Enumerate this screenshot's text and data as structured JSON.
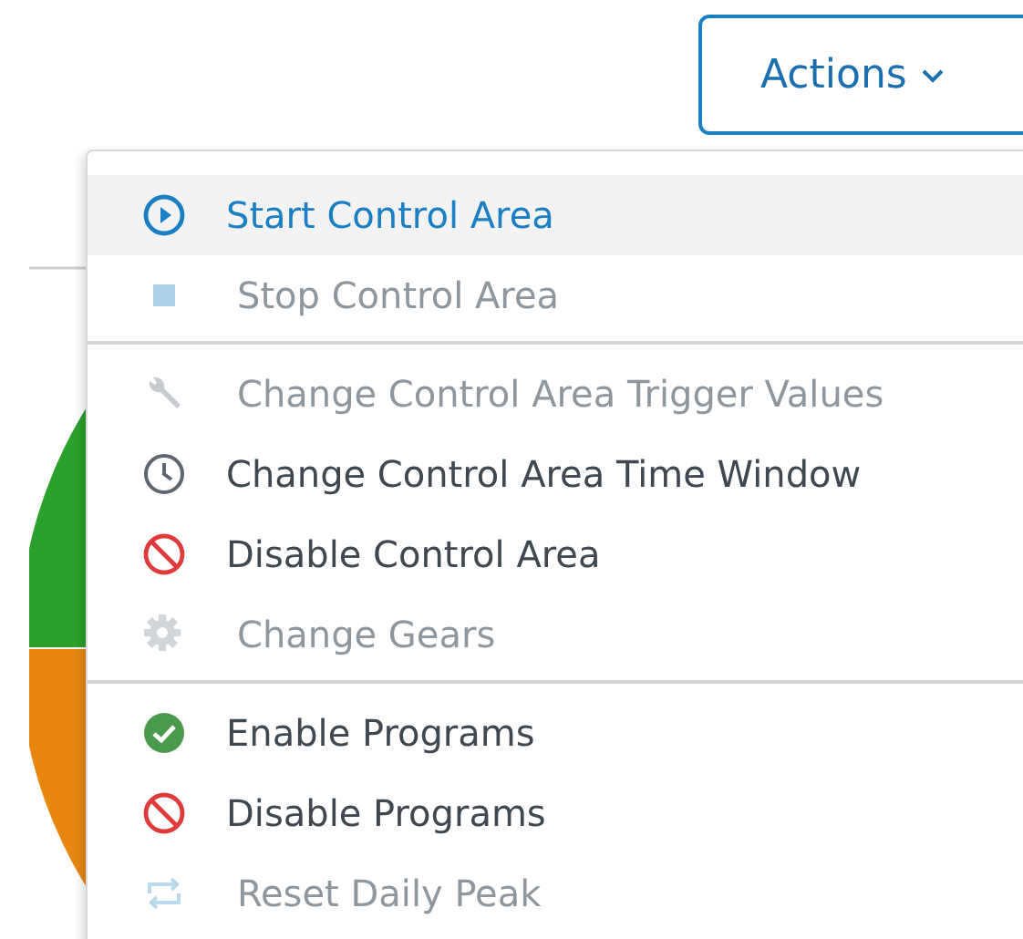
{
  "actions_button": {
    "label": "Actions"
  },
  "menu": {
    "groups": [
      {
        "items": [
          {
            "label": "Start Control Area",
            "kind": "play",
            "selected": true,
            "disabled": false
          },
          {
            "label": "Stop Control Area",
            "kind": "stop",
            "selected": false,
            "disabled": true
          }
        ]
      },
      {
        "items": [
          {
            "label": "Change Control Area Trigger Values",
            "kind": "wrench",
            "selected": false,
            "disabled": true
          },
          {
            "label": "Change Control Area Time Window",
            "kind": "clock",
            "selected": false,
            "disabled": false
          },
          {
            "label": "Disable Control Area",
            "kind": "ban",
            "selected": false,
            "disabled": false
          },
          {
            "label": "Change Gears",
            "kind": "gear",
            "selected": false,
            "disabled": true
          }
        ]
      },
      {
        "items": [
          {
            "label": "Enable Programs",
            "kind": "check",
            "selected": false,
            "disabled": false
          },
          {
            "label": "Disable Programs",
            "kind": "ban",
            "selected": false,
            "disabled": false
          },
          {
            "label": "Reset Daily Peak",
            "kind": "repeat",
            "selected": false,
            "disabled": true
          }
        ]
      }
    ]
  }
}
